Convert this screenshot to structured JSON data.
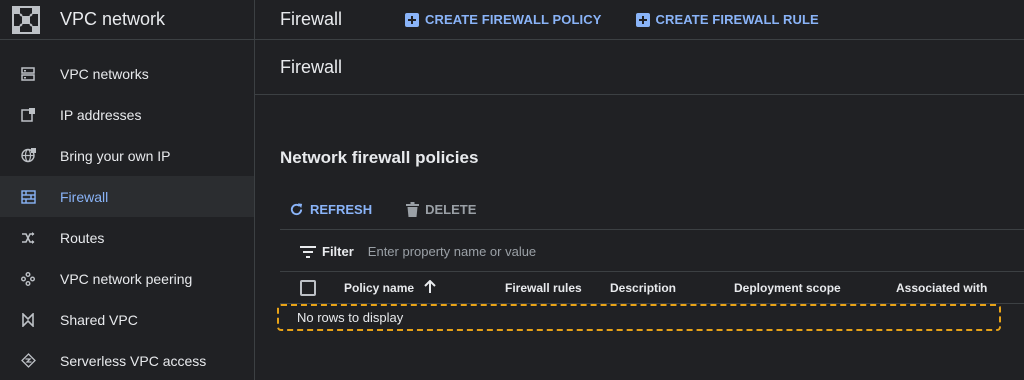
{
  "sidebar": {
    "title": "VPC network",
    "items": [
      {
        "label": "VPC networks",
        "icon": "networks-icon"
      },
      {
        "label": "IP addresses",
        "icon": "ip-address-icon"
      },
      {
        "label": "Bring your own IP",
        "icon": "globe-icon"
      },
      {
        "label": "Firewall",
        "icon": "firewall-icon",
        "active": true
      },
      {
        "label": "Routes",
        "icon": "routes-icon"
      },
      {
        "label": "VPC network peering",
        "icon": "peering-icon"
      },
      {
        "label": "Shared VPC",
        "icon": "shared-vpc-icon"
      },
      {
        "label": "Serverless VPC access",
        "icon": "serverless-icon"
      }
    ]
  },
  "header": {
    "title": "Firewall",
    "create_policy": "CREATE FIREWALL POLICY",
    "create_rule": "CREATE FIREWALL RULE"
  },
  "page": {
    "title": "Firewall",
    "section_title": "Network firewall policies"
  },
  "actions": {
    "refresh": "REFRESH",
    "delete": "DELETE"
  },
  "filter": {
    "label": "Filter",
    "placeholder": "Enter property name or value"
  },
  "table": {
    "columns": [
      "Policy name",
      "Firewall rules",
      "Description",
      "Deployment scope",
      "Associated with"
    ],
    "empty_message": "No rows to display"
  },
  "colors": {
    "accent": "#8ab4f8",
    "background": "#202124",
    "highlight": "#e8a317"
  }
}
